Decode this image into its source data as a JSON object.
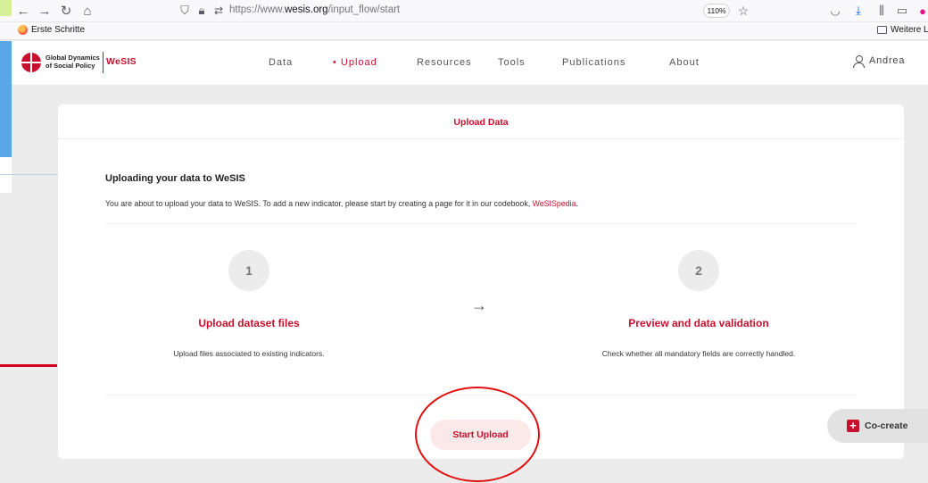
{
  "browser": {
    "url_prefix": "https://www.",
    "url_domain": "wesis.org",
    "url_path": "/input_flow/start",
    "zoom": "110%",
    "bookmarks": [
      {
        "label": "Erste Schritte"
      },
      {
        "label": "Weitere Lese"
      }
    ]
  },
  "header": {
    "logo_line1": "Global Dynamics",
    "logo_line2": "of Social Policy",
    "brand": "WeSIS",
    "nav": [
      {
        "label": "Data"
      },
      {
        "label": "• Upload"
      },
      {
        "label": "Resources"
      },
      {
        "label": "Tools"
      },
      {
        "label": "Publications"
      },
      {
        "label": "About"
      }
    ],
    "user_name": "Andrea"
  },
  "card": {
    "title": "Upload Data",
    "section_title": "Uploading your data to WeSIS",
    "intro_text": "You are about to upload your data to WeSIS. To add a new indicator, please start by creating a page for it in our codebook, ",
    "intro_link": "WeSISpedia",
    "intro_end": ".",
    "steps": [
      {
        "number": "1",
        "title": "Upload dataset files",
        "description": "Upload files associated to existing indicators."
      },
      {
        "number": "2",
        "title": "Preview and data validation",
        "description": "Check whether all mandatory fields are correctly handled."
      }
    ],
    "arrow": "→",
    "start_label": "Start Upload"
  },
  "cocreate": {
    "label": "Co-create"
  },
  "colors": {
    "accent": "#c8102e",
    "annotation": "#e01010"
  }
}
